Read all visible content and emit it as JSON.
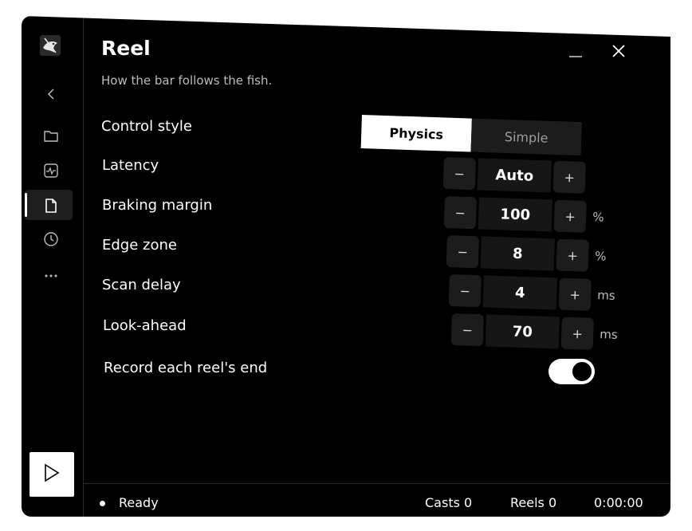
{
  "window": {
    "title": "Reel",
    "subtitle": "How the bar follows the fish.",
    "minimize_icon": "minimize-icon",
    "close_icon": "close-icon"
  },
  "sidebar": {
    "logo_icon": "fish-logo-icon",
    "items": [
      {
        "icon": "back-chevron-icon"
      },
      {
        "icon": "folder-icon"
      },
      {
        "icon": "activity-icon"
      },
      {
        "icon": "document-icon",
        "active": true
      },
      {
        "icon": "clock-icon"
      },
      {
        "icon": "more-icon"
      }
    ],
    "play_icon": "play-icon"
  },
  "settings": {
    "control_style": {
      "label": "Control style",
      "options": [
        "Physics",
        "Simple"
      ],
      "selected": "Physics"
    },
    "latency": {
      "label": "Latency",
      "value": "Auto",
      "unit": ""
    },
    "braking_margin": {
      "label": "Braking margin",
      "value": "100",
      "unit": "%"
    },
    "edge_zone": {
      "label": "Edge zone",
      "value": "8",
      "unit": "%"
    },
    "scan_delay": {
      "label": "Scan delay",
      "value": "4",
      "unit": "ms"
    },
    "look_ahead": {
      "label": "Look-ahead",
      "value": "70",
      "unit": "ms"
    },
    "record_end": {
      "label": "Record each reel's end",
      "enabled": true
    },
    "stepper_minus": "−",
    "stepper_plus": "+"
  },
  "status": {
    "state": "Ready",
    "casts": "Casts 0",
    "reels": "Reels 0",
    "time": "0:00:00"
  },
  "colors": {
    "background": "#000000",
    "accent": "#ffffff",
    "control_bg": "#1c1c1c",
    "muted_text": "#bdbdbd"
  }
}
